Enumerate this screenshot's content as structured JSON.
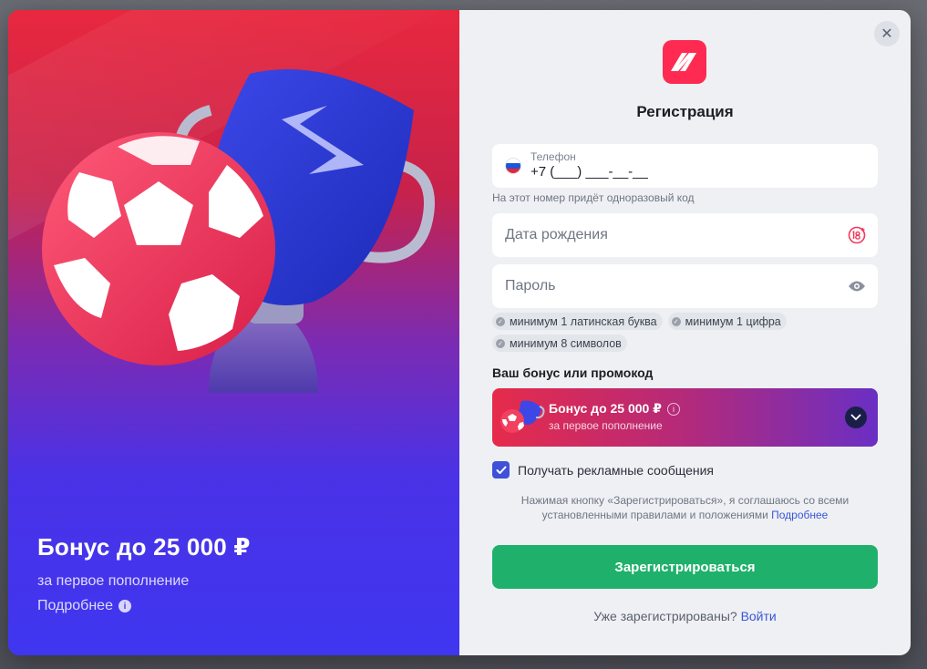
{
  "promo": {
    "title": "Бонус до 25 000 ₽",
    "subtitle": "за первое пополнение",
    "more_label": "Подробнее",
    "info_glyph": "i"
  },
  "form": {
    "close_glyph": "✕",
    "title": "Регистрация",
    "phone": {
      "label": "Телефон",
      "value": "+7 (___) ___-__-__",
      "hint": "На этот номер придёт одноразовый код",
      "flag_colors": [
        "#ffffff",
        "#1c57d8",
        "#e4263b"
      ]
    },
    "birthdate": {
      "placeholder": "Дата рождения",
      "icon": "age-18-plus-icon"
    },
    "password": {
      "placeholder": "Пароль",
      "icon": "eye-icon"
    },
    "password_rules": [
      "минимум 1 латинская буква",
      "минимум 1 цифра",
      "минимум 8 символов"
    ],
    "bonus": {
      "heading": "Ваш бонус или промокод",
      "title": "Бонус до 25 000 ₽",
      "subtitle": "за первое пополнение",
      "info_glyph": "i"
    },
    "ads_checkbox": {
      "label": "Получать рекламные сообщения",
      "checked": true
    },
    "terms": {
      "text": "Нажимая кнопку «Зарегистрироваться», я соглашаюсь со всеми установленными правилами и положениями",
      "link": "Подробнее"
    },
    "submit_label": "Зарегистрироваться",
    "login_prompt": "Уже зарегистрированы?",
    "login_link": "Войти"
  },
  "colors": {
    "accent_red": "#ff2a52",
    "submit_green": "#1fb16b",
    "link_blue": "#3b56d6",
    "checkbox_blue": "#3f51d9"
  }
}
